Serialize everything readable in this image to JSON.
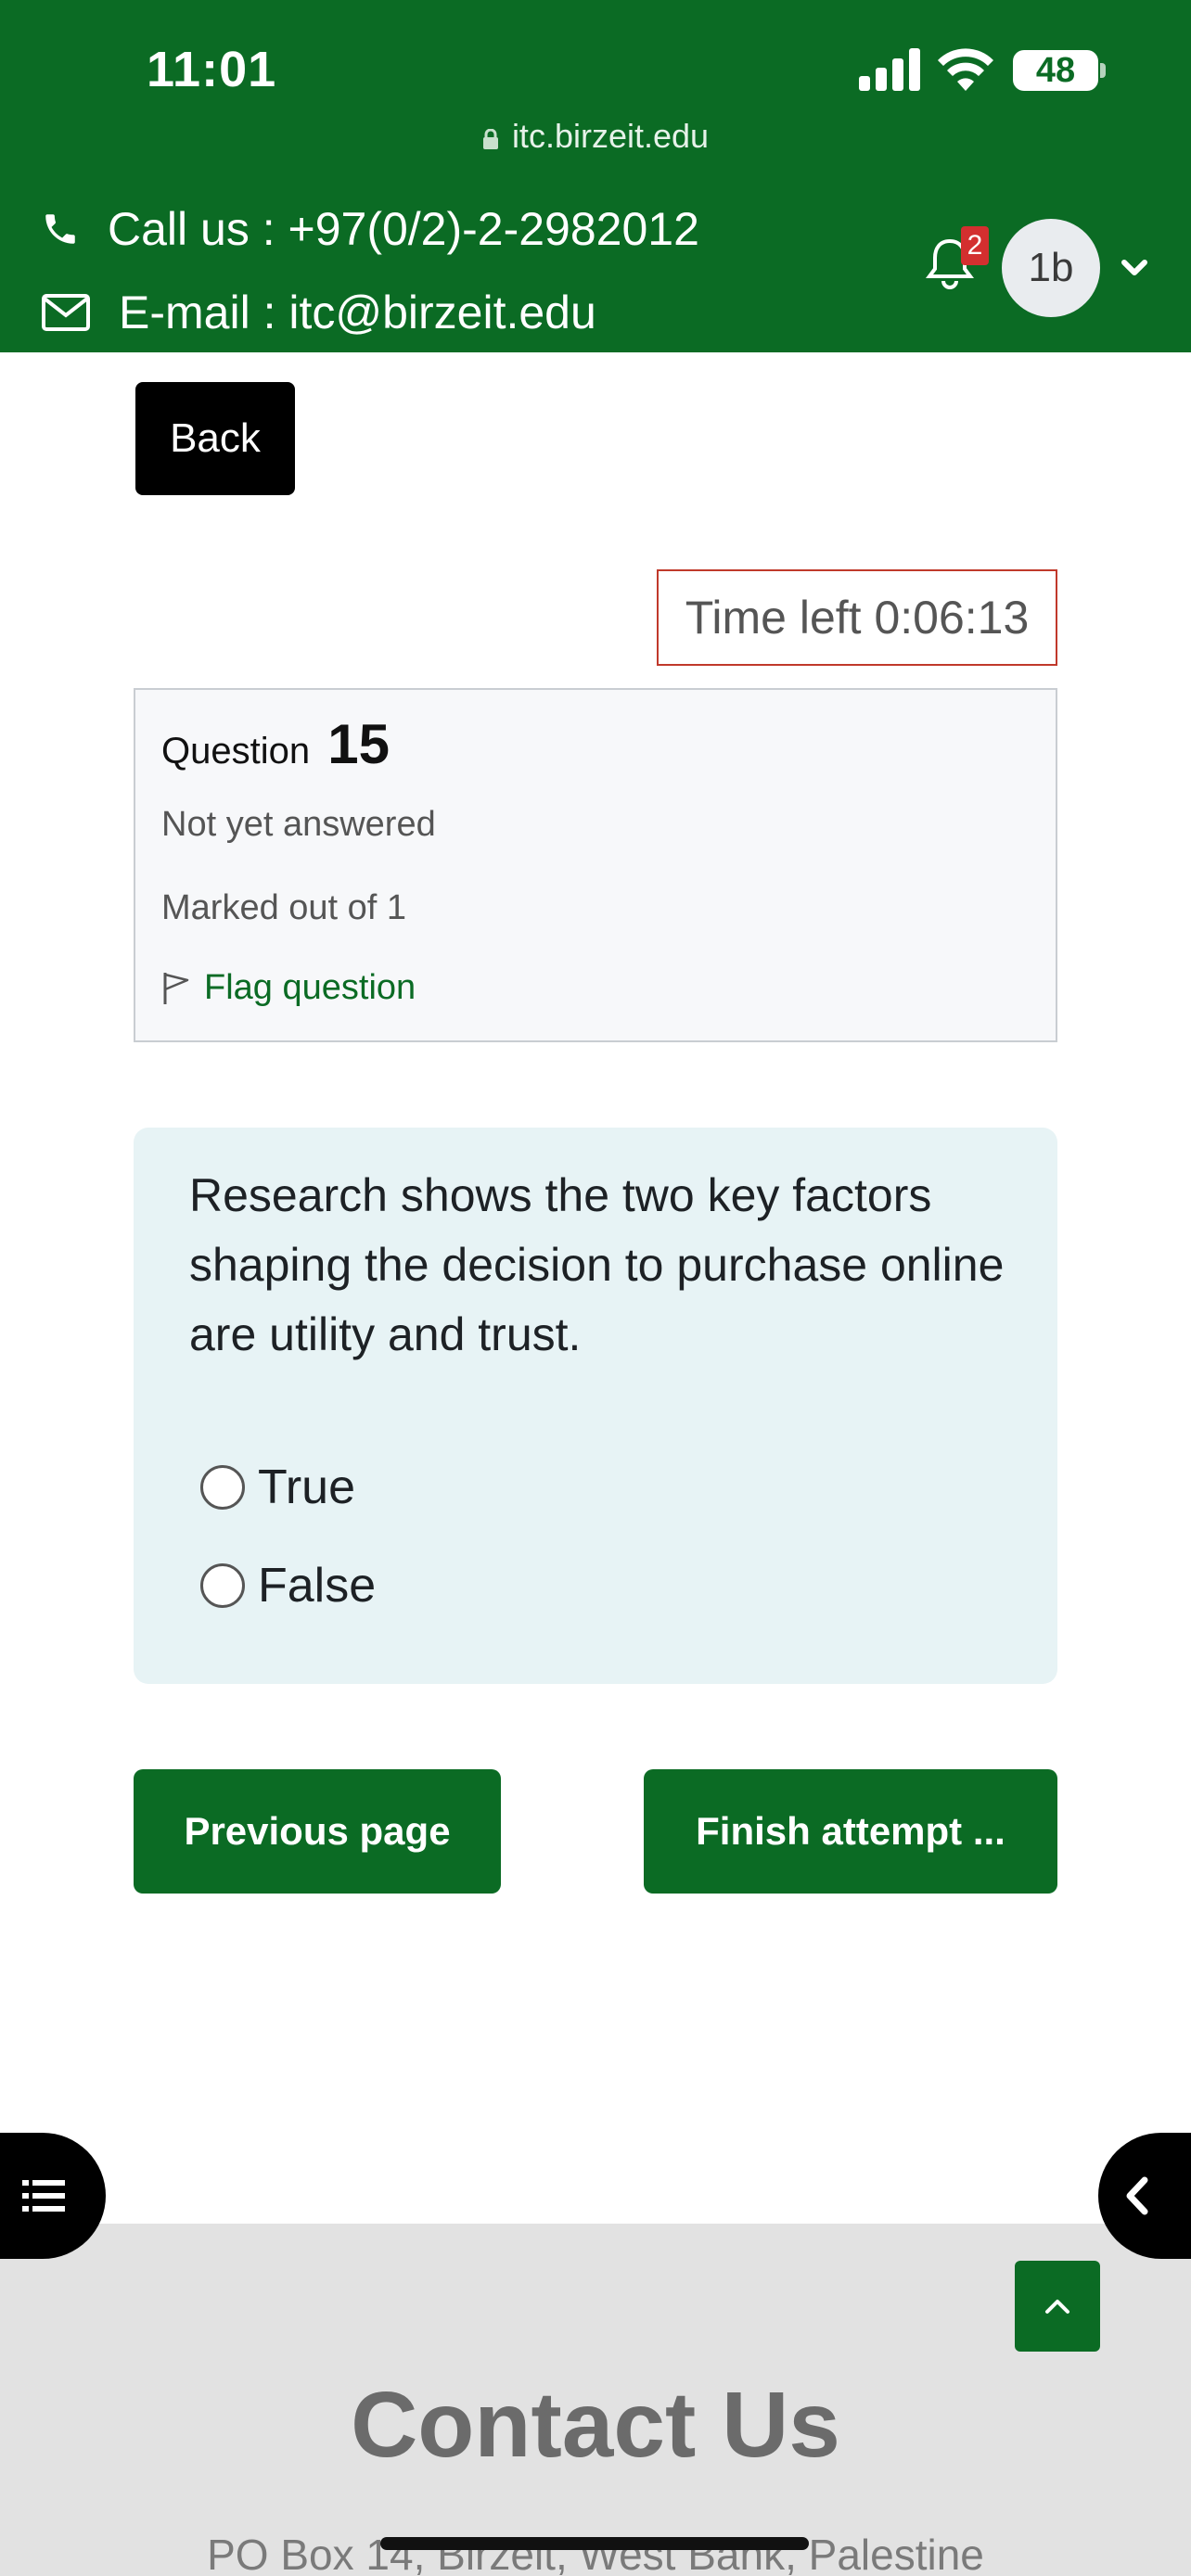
{
  "status_bar": {
    "time": "11:01",
    "battery": "48",
    "url": "itc.birzeit.edu"
  },
  "header": {
    "phone_text": "Call us : +97(0/2)-2-2982012",
    "email_text": "E-mail : itc@birzeit.edu",
    "notification_count": "2",
    "avatar_initials": "1b",
    "brand_color": "#0b6b24"
  },
  "quiz": {
    "back_label": "Back",
    "time_left": "Time left 0:06:13",
    "question_label": "Question",
    "question_number": "15",
    "state": "Not yet answered",
    "grade": "Marked out of 1",
    "flag_label": "Flag question",
    "question_text": "Research shows the two key factors shaping the decision to purchase online are utility and trust.",
    "options": [
      "True",
      "False"
    ],
    "prev_label": "Previous page",
    "finish_label": "Finish attempt ..."
  },
  "footer": {
    "title": "Contact Us",
    "address": "PO Box 14, Birzeit, West Bank, Palestine"
  },
  "icons": {
    "phone": "phone-icon",
    "email": "envelope-icon",
    "notifications": "bell-icon",
    "menu": "chevron-down-icon",
    "flag": "flag-icon",
    "drawer_left": "list-icon",
    "drawer_right": "chevron-left-icon",
    "back_to_top": "chevron-up-icon"
  }
}
